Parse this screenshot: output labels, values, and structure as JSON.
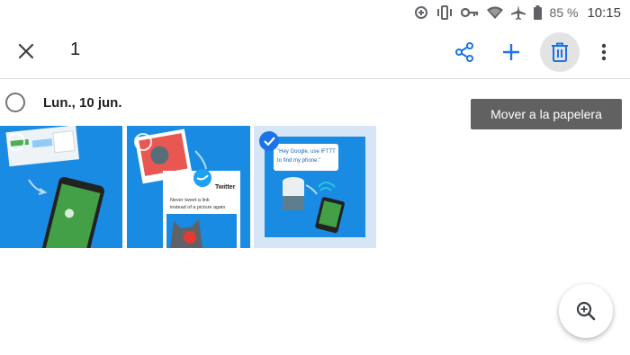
{
  "status_bar": {
    "icons": [
      "data-saver-icon",
      "vibrate-icon",
      "vpn-key-icon",
      "wifi-icon",
      "airplane-icon",
      "battery-icon"
    ],
    "battery": "85 %",
    "time": "10:15"
  },
  "toolbar": {
    "selected_count": "1",
    "actions": [
      "close-icon",
      "share-icon",
      "add-icon",
      "trash-icon",
      "more-vert-icon"
    ]
  },
  "group": {
    "date_label": "Lun., 10 jun."
  },
  "tooltip": {
    "text": "Mover a la papelera"
  },
  "photos": [
    {
      "selected": false,
      "caption": ""
    },
    {
      "selected": false,
      "card_title": "Twitter",
      "card_text": "Never tweet a link instead of a picture again"
    },
    {
      "selected": true,
      "bubble_text": "\"Hey Google, use IFTTT to find my phone.\""
    }
  ],
  "colors": {
    "accent": "#1a73e8",
    "photo_bg": "#1a8be3",
    "tooltip_bg": "#616161"
  }
}
